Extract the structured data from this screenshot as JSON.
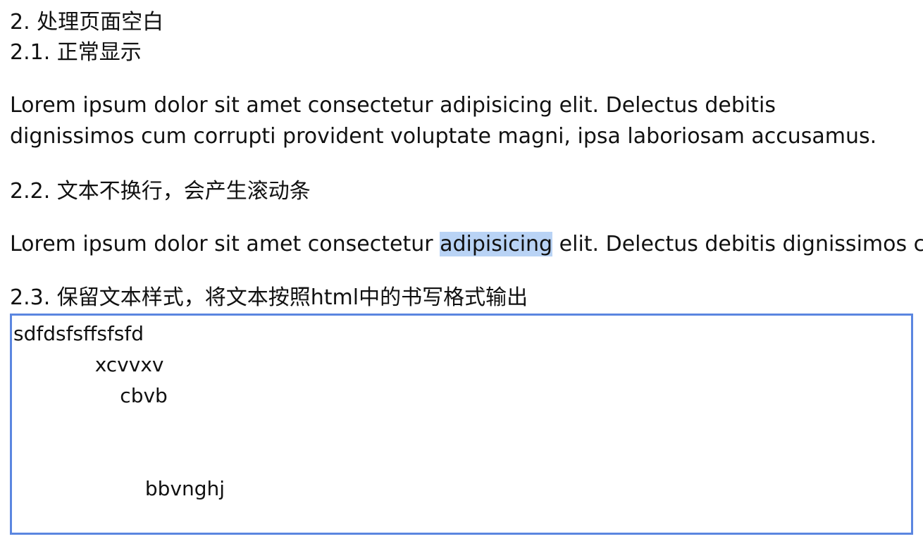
{
  "section": {
    "title": "2. 处理页面空白"
  },
  "normal": {
    "heading": "2.1. 正常显示",
    "text": "Lorem ipsum dolor sit amet consectetur adipisicing elit. Delectus debitis dignissimos cum corrupti provident voluptate magni, ipsa laboriosam accusamus."
  },
  "nowrap": {
    "heading": "2.2. 文本不换行，会产生滚动条",
    "text_before": "Lorem ipsum dolor sit amet consectetur ",
    "text_selected": "adipisicing",
    "text_after": " elit. Delectus debitis dignissimos cum corrupti provident voluptate magni, ipsa laboriosam accusamus."
  },
  "pre": {
    "heading": "2.3. 保留文本样式，将文本按照html中的书写格式输出",
    "text": "sdfdsfsffsfsfd\n             xcvvxv\n                 cbvb\n\n\n                     bbvnghj"
  },
  "colors": {
    "selection": "#b9d3f5",
    "box_border": "#5b86e0"
  }
}
